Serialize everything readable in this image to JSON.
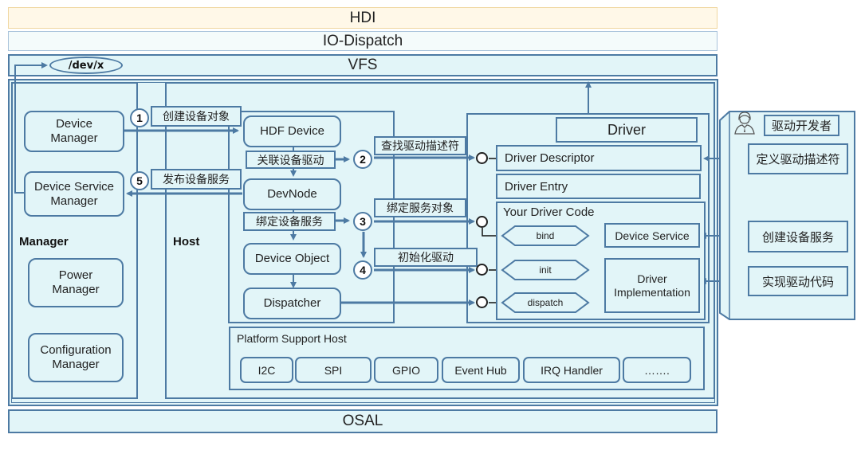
{
  "layers": {
    "hdi": "HDI",
    "io_dispatch": "IO-Dispatch",
    "vfs": "VFS",
    "dev_node_path": "/dev/x",
    "osal": "OSAL"
  },
  "manager": {
    "title": "Manager",
    "device_manager": "Device Manager",
    "device_service_manager": "Device Service Manager",
    "power_manager": "Power Manager",
    "configuration_manager": "Configuration Manager"
  },
  "host": {
    "title": "Host",
    "hdf_device": "HDF Device",
    "devnode": "DevNode",
    "device_object": "Device Object",
    "dispatcher": "Dispatcher",
    "link_driver": "关联设备驱动",
    "bind_service": "绑定设备服务"
  },
  "steps": [
    {
      "num": "1",
      "label": "创建设备对象"
    },
    {
      "num": "2",
      "label": "查找驱动描述符"
    },
    {
      "num": "3",
      "label": "绑定服务对象"
    },
    {
      "num": "4",
      "label": "初始化驱动"
    },
    {
      "num": "5",
      "label": "发布设备服务"
    }
  ],
  "driver": {
    "title": "Driver",
    "descriptor": "Driver Descriptor",
    "entry": "Driver Entry",
    "your_code": "Your Driver Code",
    "bind": "bind",
    "init": "init",
    "dispatch": "dispatch",
    "device_service": "Device Service",
    "implementation": "Driver Implementation"
  },
  "platform": {
    "title": "Platform Support Host",
    "items": [
      "I2C",
      "SPI",
      "GPIO",
      "Event Hub",
      "IRQ Handler",
      "……."
    ]
  },
  "developer": {
    "title": "驱动开发者",
    "steps": [
      "定义驱动描述符",
      "创建设备服务",
      "实现驱动代码"
    ]
  },
  "icons": {
    "developer": "person-icon",
    "interface": "interface-circle-icon"
  },
  "colors": {
    "line": "#4d7aa3",
    "panel_fill": "#e2f5f8",
    "hdi_fill": "#fff8e8",
    "hdi_border": "#f0d7a0"
  }
}
